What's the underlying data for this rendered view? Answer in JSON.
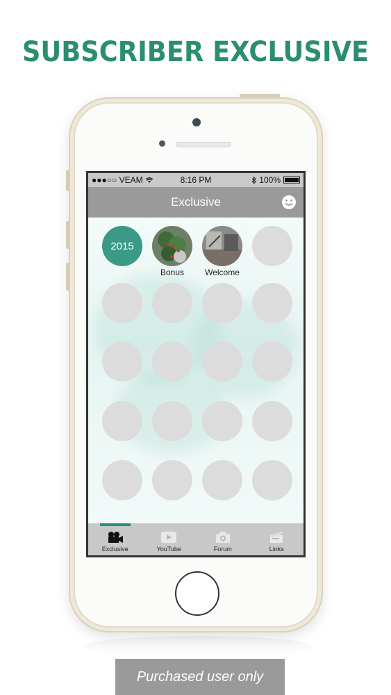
{
  "headline": {
    "text": "SUBSCRIBER EXCLUSIVE",
    "color": "#2b8e70"
  },
  "status_bar": {
    "carrier": "●●●○○ VEAM",
    "time": "8:16 PM",
    "battery": "100%"
  },
  "nav": {
    "title": "Exclusive",
    "right_icon": "smiley-icon"
  },
  "grid": {
    "year_label": "2015",
    "items": [
      {
        "label": "Bonus",
        "icon": "plant-photo"
      },
      {
        "label": "Welcome",
        "icon": "room-photo"
      }
    ]
  },
  "tabs": [
    {
      "label": "Exclusive",
      "icon": "video-camera-icon",
      "active": true
    },
    {
      "label": "YouTube",
      "icon": "play-icon",
      "active": false
    },
    {
      "label": "Forum",
      "icon": "camera-icon",
      "active": false
    },
    {
      "label": "Links",
      "icon": "links-icon",
      "active": false
    }
  ],
  "banner": {
    "text": "Purchased user only"
  },
  "colors": {
    "accent": "#2b8e78",
    "placeholder": "#dcdcdc",
    "navbar": "#9a9a9a"
  }
}
